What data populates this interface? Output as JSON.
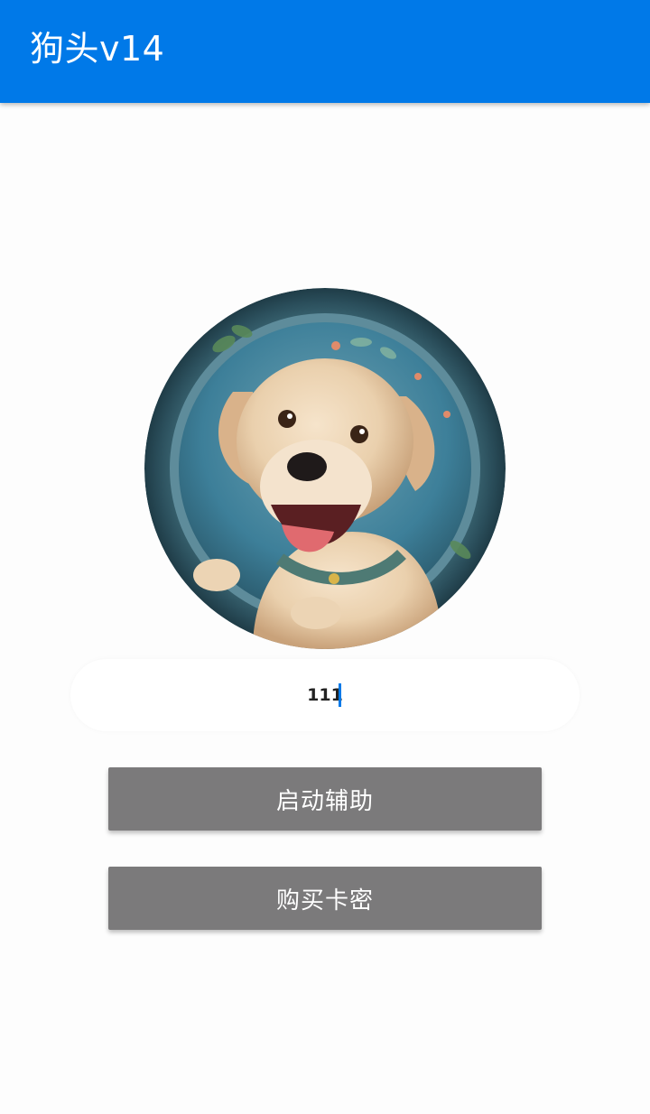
{
  "app_bar": {
    "title": "狗头v14",
    "color": "#0079e8"
  },
  "avatar": {
    "icon": "dog-avatar"
  },
  "key_input": {
    "value": "111"
  },
  "buttons": {
    "start_label": "启动辅助",
    "buy_label": "购买卡密",
    "color": "#7b7a7b"
  }
}
